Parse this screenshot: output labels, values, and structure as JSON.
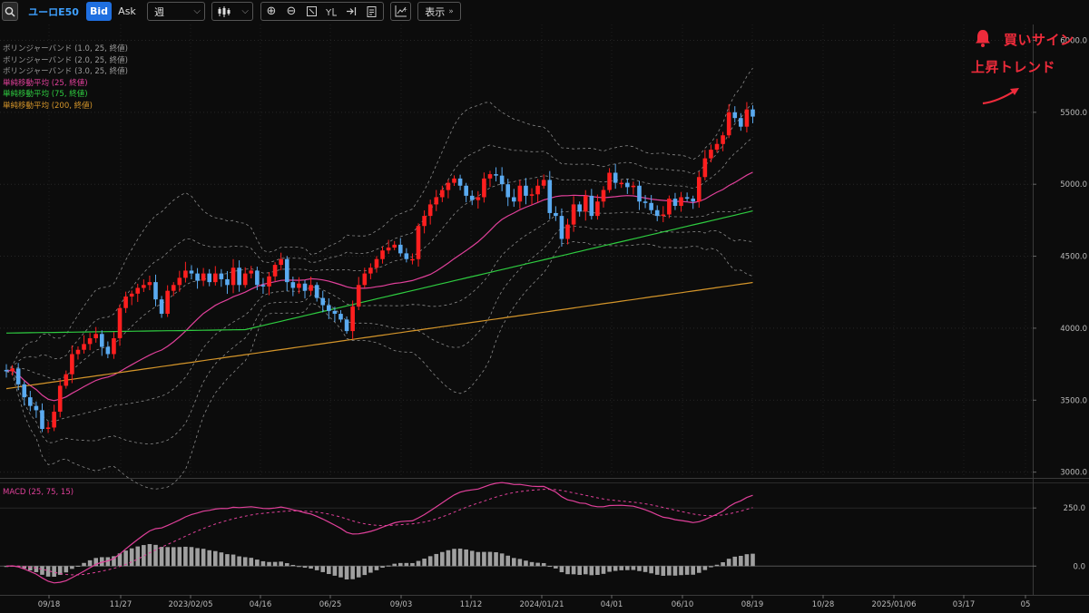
{
  "toolbar": {
    "symbol": "ユーロE50",
    "bid": "Bid",
    "ask": "Ask",
    "period": "週",
    "display": "表示",
    "display_arrow": "»"
  },
  "legend": [
    {
      "text": "ボリンジャーバンド (1.0, 25, 終値)",
      "color": "#9a9a9a"
    },
    {
      "text": "ボリンジャーバンド (2.0, 25, 終値)",
      "color": "#9a9a9a"
    },
    {
      "text": "ボリンジャーバンド (3.0, 25, 終値)",
      "color": "#9a9a9a"
    },
    {
      "text": "単純移動平均 (25, 終値)",
      "color": "#e0409a"
    },
    {
      "text": "単純移動平均 (75, 終値)",
      "color": "#2ecc40"
    },
    {
      "text": "単純移動平均 (200, 終値)",
      "color": "#d4952a"
    }
  ],
  "annotation": {
    "buy_sign": "買いサイン",
    "uptrend": "上昇トレンド",
    "color": "#ee2b3b"
  },
  "macd": {
    "label": "MACD (25, 75, 15)",
    "color": "#e0409a",
    "y_ticks": [
      "250.0",
      "0.0"
    ]
  },
  "chart_data": {
    "type": "candlestick",
    "title": "",
    "y_ticks": [
      "6000.0",
      "5500.0",
      "5000.0",
      "4500.0",
      "4000.0",
      "3500.0",
      "3000.0"
    ],
    "ylim": [
      2960,
      6110
    ],
    "x_ticks": [
      "09/18",
      "11/27",
      "2023/02/05",
      "04/16",
      "06/25",
      "09/03",
      "11/12",
      "2024/01/21",
      "04/01",
      "06/10",
      "08/19",
      "10/28",
      "2025/01/06",
      "03/17",
      "05"
    ],
    "colors": {
      "up": "#ff1f1f",
      "down": "#5aaaf0",
      "bb": "#8a8a8a",
      "sma25": "#e0409a",
      "sma75": "#2ecc40",
      "sma200": "#d4952a",
      "macd": "#e0409a",
      "hist": "#a0a0a0"
    },
    "candles": [
      3700,
      3720,
      3610,
      3520,
      3460,
      3430,
      3300,
      3310,
      3420,
      3600,
      3680,
      3820,
      3850,
      3890,
      3930,
      3960,
      3870,
      3820,
      3930,
      4140,
      4220,
      4240,
      4280,
      4300,
      4320,
      4200,
      4100,
      4260,
      4300,
      4350,
      4400,
      4380,
      4330,
      4380,
      4320,
      4380,
      4340,
      4300,
      4420,
      4300,
      4380,
      4400,
      4300,
      4290,
      4360,
      4440,
      4480,
      4320,
      4280,
      4310,
      4260,
      4300,
      4210,
      4160,
      4120,
      4100,
      4060,
      3980,
      4150,
      4300,
      4380,
      4420,
      4480,
      4540,
      4560,
      4580,
      4520,
      4480,
      4480,
      4710,
      4780,
      4860,
      4910,
      4960,
      5010,
      5040,
      4990,
      4920,
      4890,
      4910,
      5040,
      5070,
      5060,
      5000,
      4910,
      4880,
      4990,
      4920,
      4930,
      4990,
      5030,
      4800,
      4780,
      4620,
      4720,
      4860,
      4810,
      4920,
      4780,
      4880,
      4960,
      5080,
      5010,
      5010,
      4980,
      4990,
      4880,
      4870,
      4820,
      4780,
      4790,
      4900,
      4850,
      4910,
      4900,
      4880,
      5050,
      5180,
      5240,
      5280,
      5340,
      5500,
      5460,
      5400,
      5520,
      5470
    ]
  }
}
